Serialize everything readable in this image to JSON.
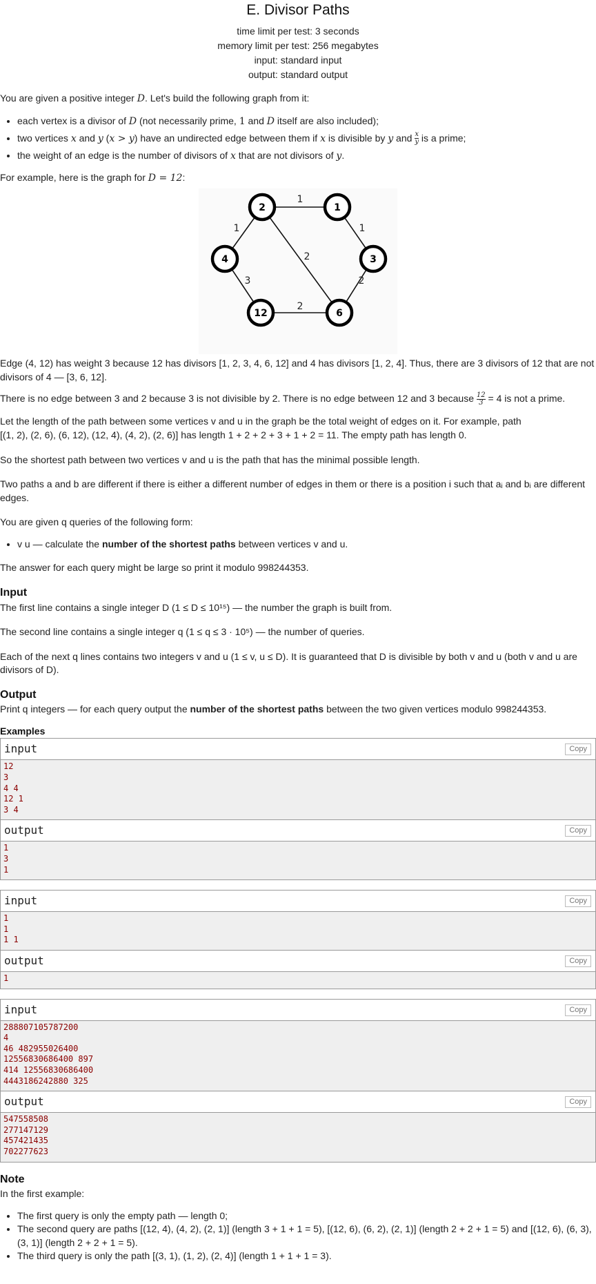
{
  "problem": {
    "title": "E. Divisor Paths",
    "time_limit": "time limit per test: 3 seconds",
    "memory_limit": "memory limit per test: 256 megabytes",
    "input_file": "input: standard input",
    "output_file": "output: standard output"
  },
  "statement": {
    "intro_1": "You are given a positive integer ",
    "intro_D": "D",
    "intro_2": ". Let's build the following graph from it:",
    "bullet_1a": "each vertex is a divisor of ",
    "bullet_1b": " (not necessarily prime, ",
    "bullet_1c": " and ",
    "bullet_1d": " itself are also included);",
    "bullet_2a": "two vertices ",
    "bullet_2b": " and ",
    "bullet_2c": " (",
    "bullet_2d": ") have an undirected edge between them if ",
    "bullet_2e": " is divisible by ",
    "bullet_2f": " and ",
    "bullet_2g": " is a prime;",
    "bullet_3a": "the weight of an edge is the number of divisors of ",
    "bullet_3b": " that are not divisors of ",
    "bullet_3c": ".",
    "example_intro": "For example, here is the graph for ",
    "example_eq": "D = 12",
    "example_end": ":",
    "edge_text": "Edge (4, 12) has weight 3 because 12 has divisors [1, 2, 3, 4, 6, 12] and 4 has divisors [1, 2, 4]. Thus, there are 3 divisors of 12 that are not divisors of 4 — [3, 6, 12].",
    "no_edge_1": "There is no edge between 3 and 2 because 3 is not divisible by 2. There is no edge between 12 and 3 because ",
    "no_edge_frac_num": "12",
    "no_edge_frac_den": "3",
    "no_edge_2": " = 4 is not a prime.",
    "path_len_1": "Let the length of the path between some vertices v and u in the graph be the total weight of edges on it. For example, path",
    "path_len_2": "[(1, 2), (2, 6), (6, 12), (12, 4), (4, 2), (2, 6)] has length 1 + 2 + 2 + 3 + 1 + 2 = 11. The empty path has length 0.",
    "shortest_def": "So the shortest path between two vertices v and u is the path that has the minimal possible length.",
    "different_def": "Two paths a and b are different if there is either a different number of edges in them or there is a position i such that aᵢ and bᵢ are different edges.",
    "queries_intro": "You are given q queries of the following form:",
    "query_bullet_a": "v u — calculate the ",
    "query_bullet_bold": "number of the shortest paths",
    "query_bullet_b": " between vertices v and u.",
    "modulo_text": "The answer for each query might be large so print it modulo 998244353."
  },
  "input_section": {
    "title": "Input",
    "line_1": "The first line contains a single integer D (1 ≤ D ≤ 10¹⁵) — the number the graph is built from.",
    "line_2": "The second line contains a single integer q (1 ≤ q ≤ 3 · 10⁵) — the number of queries.",
    "line_3": "Each of the next q lines contains two integers v and u (1 ≤ v, u ≤ D). It is guaranteed that D is divisible by both v and u (both v and u are divisors of D)."
  },
  "output_section": {
    "title": "Output",
    "text_a": "Print q integers — for each query output the ",
    "text_bold": "number of the shortest paths",
    "text_b": " between the two given vertices modulo 998244353."
  },
  "examples": {
    "title": "Examples",
    "input_label": "input",
    "output_label": "output",
    "copy_label": "Copy",
    "tests": [
      {
        "input": "12\n3\n4 4\n12 1\n3 4",
        "output": "1\n3\n1"
      },
      {
        "input": "1\n1\n1 1",
        "output": "1"
      },
      {
        "input": "288807105787200\n4\n46 482955026400\n12556830686400 897\n414 12556830686400\n4443186242880 325",
        "output": "547558508\n277147129\n457421435\n702277623"
      }
    ]
  },
  "note": {
    "title": "Note",
    "intro": "In the first example:",
    "items": [
      "The first query is only the empty path — length 0;",
      "The second query are paths [(12, 4), (4, 2), (2, 1)] (length 3 + 1 + 1 = 5), [(12, 6), (6, 2), (2, 1)] (length 2 + 2 + 1 = 5) and [(12, 6), (6, 3), (3, 1)] (length 2 + 2 + 1 = 5).",
      "The third query is only the path [(3, 1), (1, 2), (2, 4)] (length 1 + 1 + 1 = 3)."
    ]
  },
  "graph": {
    "nodes": [
      {
        "id": "2",
        "label": "2"
      },
      {
        "id": "1",
        "label": "1"
      },
      {
        "id": "4",
        "label": "4"
      },
      {
        "id": "3",
        "label": "3"
      },
      {
        "id": "12",
        "label": "12"
      },
      {
        "id": "6",
        "label": "6"
      }
    ],
    "edges": [
      {
        "from": "2",
        "to": "1",
        "weight": "1"
      },
      {
        "from": "2",
        "to": "4",
        "weight": "1"
      },
      {
        "from": "1",
        "to": "3",
        "weight": "1"
      },
      {
        "from": "2",
        "to": "6",
        "weight": "2"
      },
      {
        "from": "4",
        "to": "12",
        "weight": "3"
      },
      {
        "from": "3",
        "to": "6",
        "weight": "2"
      },
      {
        "from": "12",
        "to": "6",
        "weight": "2"
      }
    ]
  }
}
